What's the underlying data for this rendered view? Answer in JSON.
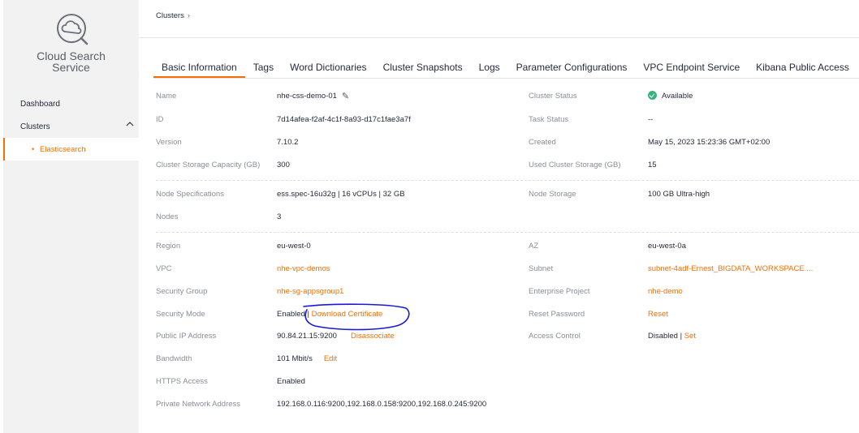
{
  "sidebar": {
    "service_name_line1": "Cloud Search",
    "service_name_line2": "Service",
    "logo_icon": "cloud-search-icon",
    "items": [
      {
        "label": "Dashboard"
      },
      {
        "label": "Clusters",
        "chevron": "chevron-up-icon"
      },
      {
        "label": "Elasticsearch",
        "active": true
      }
    ]
  },
  "breadcrumb": {
    "root": "Clusters",
    "separator": "›"
  },
  "tabs": [
    {
      "label": "Basic Information",
      "active": true
    },
    {
      "label": "Tags"
    },
    {
      "label": "Word Dictionaries"
    },
    {
      "label": "Cluster Snapshots"
    },
    {
      "label": "Logs"
    },
    {
      "label": "Parameter Configurations"
    },
    {
      "label": "VPC Endpoint Service"
    },
    {
      "label": "Kibana Public Access"
    }
  ],
  "info": {
    "name_label": "Name",
    "name_value": "nhe-css-demo-01",
    "cluster_status_label": "Cluster Status",
    "cluster_status_value": "Available",
    "id_label": "ID",
    "id_value": "7d14afea-f2af-4c1f-8a93-d17c1fae3a7f",
    "task_status_label": "Task Status",
    "task_status_value": "--",
    "version_label": "Version",
    "version_value": "7.10.2",
    "created_label": "Created",
    "created_value": "May 15, 2023 15:23:36 GMT+02:00",
    "storage_capacity_label": "Cluster Storage Capacity (GB)",
    "storage_capacity_value": "300",
    "used_storage_label": "Used Cluster Storage (GB)",
    "used_storage_value": "15",
    "node_spec_label": "Node Specifications",
    "node_spec_value": "ess.spec-16u32g | 16 vCPUs | 32 GB",
    "node_storage_label": "Node Storage",
    "node_storage_value": "100 GB Ultra-high",
    "nodes_label": "Nodes",
    "nodes_value": "3",
    "region_label": "Region",
    "region_value": "eu-west-0",
    "az_label": "AZ",
    "az_value": "eu-west-0a",
    "vpc_label": "VPC",
    "vpc_value": "nhe-vpc-demos",
    "subnet_label": "Subnet",
    "subnet_value": "subnet-4adf-Ernest_BIGDATA_WORKSPACE ...",
    "security_group_label": "Security Group",
    "security_group_value": "nhe-sg-appsgroup1",
    "enterprise_project_label": "Enterprise Project",
    "enterprise_project_value": "nhe-demo",
    "security_mode_label": "Security Mode",
    "security_mode_value": "Enabled",
    "download_cert_link": "Download Certificate",
    "reset_password_label": "Reset Password",
    "reset_password_link": "Reset",
    "public_ip_label": "Public IP Address",
    "public_ip_value": "90.84.21.15:9200",
    "disassociate_link": "Disassociate",
    "access_control_label": "Access Control",
    "access_control_value": "Disabled",
    "access_control_set_link": "Set",
    "bandwidth_label": "Bandwidth",
    "bandwidth_value": "101 Mbit/s",
    "bandwidth_edit_link": "Edit",
    "https_label": "HTTPS Access",
    "https_value": "Enabled",
    "private_network_label": "Private Network Address",
    "private_network_value": "192.168.0.116:9200,192.168.0.158:9200,192.168.0.245:9200"
  },
  "colors": {
    "accent": "#f66f00",
    "success": "#3ab27b",
    "annotation": "#1a1ad6"
  }
}
